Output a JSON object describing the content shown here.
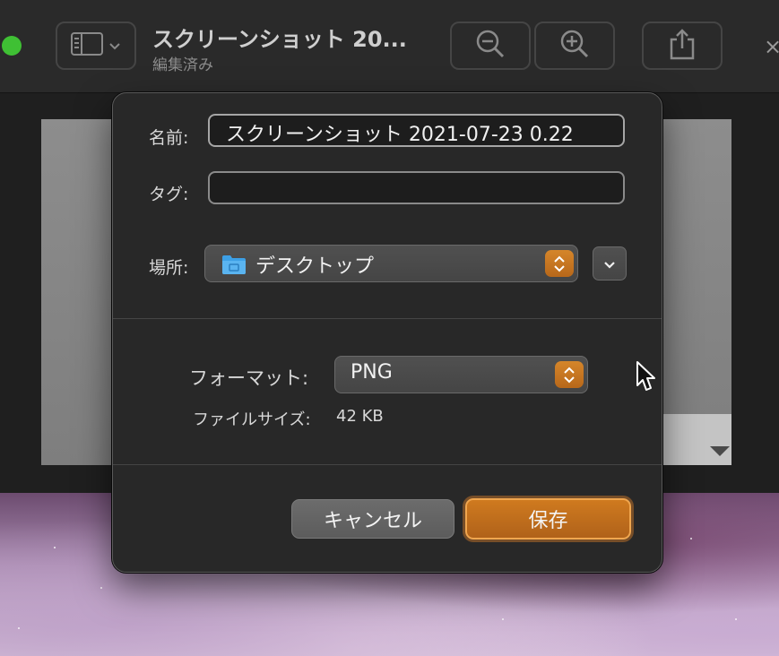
{
  "window": {
    "title": "スクリーンショット 20...",
    "subtitle": "編集済み",
    "toolbar": {
      "sidebar_icon": "sidebar-icon",
      "chevron_icon": "chevron-down-icon",
      "zoom_out_icon": "zoom-out-icon",
      "zoom_in_icon": "zoom-in-icon",
      "share_icon": "share-icon",
      "close_glyph": "×"
    }
  },
  "dialog": {
    "name_label": "名前:",
    "name_value": "スクリーンショット 2021-07-23 0.22",
    "tags_label": "タグ:",
    "tags_value": "",
    "location_label": "場所:",
    "location_value": "デスクトップ",
    "location_icon": "folder-icon",
    "expand_icon": "chevron-down-icon",
    "format_label": "フォーマット:",
    "format_value": "PNG",
    "filesize_label": "ファイルサイズ:",
    "filesize_value": "42 KB",
    "cancel_label": "キャンセル",
    "save_label": "保存"
  },
  "colors": {
    "accent": "#c8741f",
    "dialog_bg": "#282828",
    "traffic_green": "#3fc034"
  }
}
